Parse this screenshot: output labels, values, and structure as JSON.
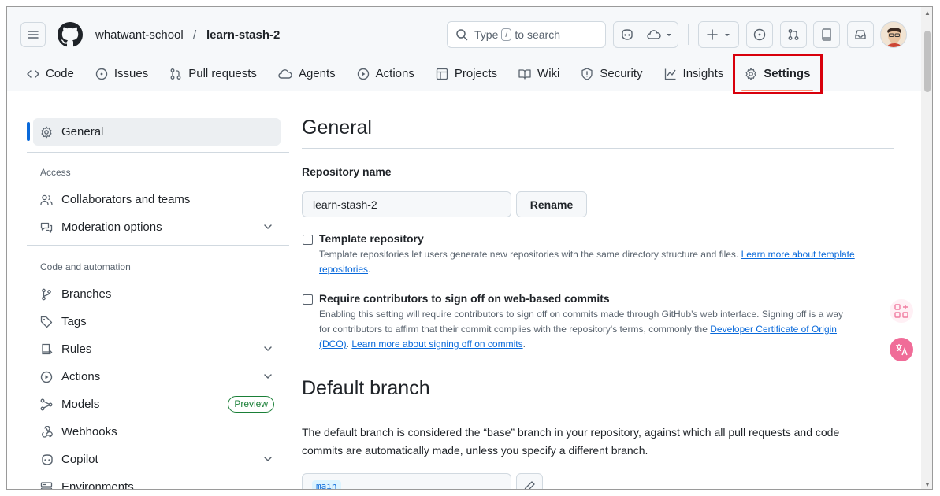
{
  "header": {
    "owner": "whatwant-school",
    "separator": "/",
    "repo": "learn-stash-2",
    "search": {
      "prefix": "Type",
      "key": "/",
      "suffix": "to search"
    },
    "buttons": [
      "copilot-icon",
      "agent-icon",
      "plus-icon",
      "issues-icon",
      "pull-requests-icon",
      "repos-icon",
      "inbox-icon"
    ]
  },
  "tabs": [
    {
      "label": "Code",
      "icon": "code-icon"
    },
    {
      "label": "Issues",
      "icon": "issue-icon"
    },
    {
      "label": "Pull requests",
      "icon": "pull-request-icon"
    },
    {
      "label": "Agents",
      "icon": "agent-icon"
    },
    {
      "label": "Actions",
      "icon": "play-icon"
    },
    {
      "label": "Projects",
      "icon": "table-icon"
    },
    {
      "label": "Wiki",
      "icon": "book-icon"
    },
    {
      "label": "Security",
      "icon": "shield-icon"
    },
    {
      "label": "Insights",
      "icon": "graph-icon"
    },
    {
      "label": "Settings",
      "icon": "gear-icon",
      "active": true
    }
  ],
  "sidebar": {
    "general": "General",
    "access_heading": "Access",
    "collaborators": "Collaborators and teams",
    "moderation": "Moderation options",
    "code_heading": "Code and automation",
    "branches": "Branches",
    "tags": "Tags",
    "rules": "Rules",
    "actions": "Actions",
    "models": "Models",
    "models_badge": "Preview",
    "webhooks": "Webhooks",
    "copilot": "Copilot",
    "environments": "Environments"
  },
  "main": {
    "general_title": "General",
    "repo_name_label": "Repository name",
    "repo_name_value": "learn-stash-2",
    "rename_button": "Rename",
    "template": {
      "label": "Template repository",
      "desc": "Template repositories let users generate new repositories with the same directory structure and files.",
      "link1": "Learn more about template",
      "link2": "repositories",
      "end": "."
    },
    "signoff": {
      "label": "Require contributors to sign off on web-based commits",
      "desc1": "Enabling this setting will require contributors to sign off on commits made through GitHub’s web interface. Signing off is a way",
      "desc2": "for contributors to affirm that their commit complies with the repository's terms, commonly the",
      "link_dco1": "Developer Certificate of Origin",
      "link_dco2": "(DCO)",
      "mid": ".",
      "link_learn": "Learn more about signing off on commits",
      "end": "."
    },
    "default_branch_title": "Default branch",
    "default_branch_desc1": "The default branch is considered the “base” branch in your repository, against which all pull requests and code",
    "default_branch_desc2": "commits are automatically made, unless you specify a different branch.",
    "branch_value": "main"
  },
  "colors": {
    "accent": "#0969da",
    "active_tab_underline": "#fd8c73",
    "highlight_box": "#d8000c",
    "preview_badge": "#1a7f37"
  }
}
